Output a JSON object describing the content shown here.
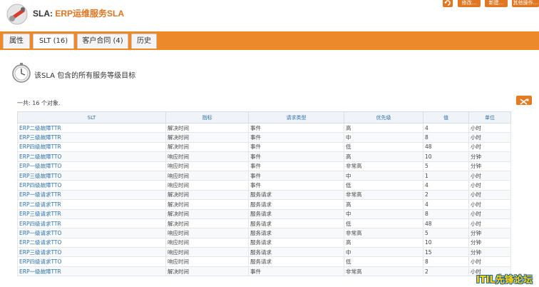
{
  "header": {
    "title_prefix": "SLA: ",
    "title_object": "ERP运维服务SLA",
    "buttons": [
      "修改...",
      "新建...",
      "其他操作..."
    ]
  },
  "tabs": [
    {
      "label": "属性",
      "active": false
    },
    {
      "label": "SLT (16)",
      "active": true
    },
    {
      "label": "客户合同 (4)",
      "active": false
    },
    {
      "label": "历史",
      "active": false
    }
  ],
  "intro": {
    "text": "该SLA 包含的所有服务等级目标"
  },
  "count_text": "一共: 16 个对象.",
  "table": {
    "columns": [
      "SLT",
      "指标",
      "请求类型",
      "优先级",
      "值",
      "单位"
    ],
    "rows": [
      [
        "ERP二级故障TTR",
        "解决时间",
        "事件",
        "高",
        "4",
        "小时"
      ],
      [
        "ERP三级故障TTR",
        "解决时间",
        "事件",
        "中",
        "8",
        "小时"
      ],
      [
        "ERP四级故障TTR",
        "解决时间",
        "事件",
        "低",
        "48",
        "小时"
      ],
      [
        "ERP二级故障TTO",
        "响应时间",
        "事件",
        "高",
        "10",
        "分钟"
      ],
      [
        "ERP一级故障TTO",
        "响应时间",
        "事件",
        "非常高",
        "5",
        "分钟"
      ],
      [
        "ERP三级故障TTO",
        "响应时间",
        "事件",
        "中",
        "1",
        "小时"
      ],
      [
        "ERP四级故障TTO",
        "响应时间",
        "事件",
        "低",
        "4",
        "小时"
      ],
      [
        "ERP一级请求TTR",
        "解决时间",
        "服务请求",
        "非常高",
        "2",
        "小时"
      ],
      [
        "ERP二级请求TTR",
        "解决时间",
        "服务请求",
        "高",
        "4",
        "小时"
      ],
      [
        "ERP三级请求TTR",
        "解决时间",
        "服务请求",
        "中",
        "8",
        "小时"
      ],
      [
        "ERP四级请求TTR",
        "解决时间",
        "服务请求",
        "低",
        "48",
        "小时"
      ],
      [
        "ERP一级请求TTO",
        "响应时间",
        "服务请求",
        "非常高",
        "5",
        "分钟"
      ],
      [
        "ERP二级请求TTO",
        "响应时间",
        "服务请求",
        "高",
        "10",
        "分钟"
      ],
      [
        "ERP三级请求TTO",
        "响应时间",
        "服务请求",
        "中",
        "15",
        "分钟"
      ],
      [
        "ERP四级请求TTO",
        "响应时间",
        "服务请求",
        "低",
        "8",
        "小时"
      ],
      [
        "ERP一级故障TTR",
        "解决时间",
        "事件",
        "非常高",
        "2",
        "小时"
      ]
    ]
  },
  "watermark": "ITIL先锋论坛"
}
